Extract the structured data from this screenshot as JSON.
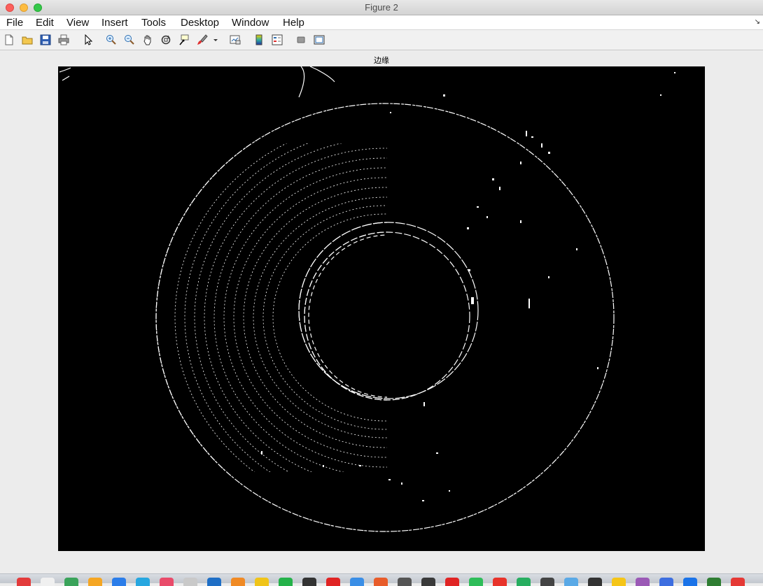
{
  "window": {
    "title": "Figure 2",
    "controls": [
      "close",
      "minimize",
      "zoom"
    ]
  },
  "menubar": {
    "items": [
      "File",
      "Edit",
      "View",
      "Insert",
      "Tools",
      "Desktop",
      "Window",
      "Help"
    ]
  },
  "toolbar": {
    "buttons": [
      "new-figure-icon",
      "open-icon",
      "save-icon",
      "print-icon",
      "pointer-icon",
      "zoom-in-icon",
      "zoom-out-icon",
      "pan-icon",
      "rotate-3d-icon",
      "data-cursor-icon",
      "brush-icon",
      "brush-dropdown-icon",
      "link-plot-icon",
      "colorbar-icon",
      "legend-icon",
      "hide-tools-icon",
      "show-tools-icon"
    ]
  },
  "figure": {
    "axes_title": "边缘",
    "image_description": "binary edge map of a disc on black background",
    "foreground": "#ffffff",
    "background": "#000000"
  },
  "dock": {
    "icon_colors": [
      "#e33b3b",
      "#f0f0f0",
      "#3aa35a",
      "#f5a623",
      "#2b7de9",
      "#27a7e0",
      "#e94b6a",
      "#c9c9c9",
      "#1f6fc6",
      "#f08a24",
      "#f0c419",
      "#25b24a",
      "#333333",
      "#e02424",
      "#3a8ee6",
      "#e85c2a",
      "#555555",
      "#3a3a3a",
      "#e02424",
      "#2ebd59",
      "#e8332a",
      "#27ae60",
      "#444444",
      "#5aa9e6",
      "#333333",
      "#f5c518",
      "#9b59b6",
      "#3d6ee0",
      "#1a73e8",
      "#2e7d32",
      "#e53935"
    ]
  }
}
